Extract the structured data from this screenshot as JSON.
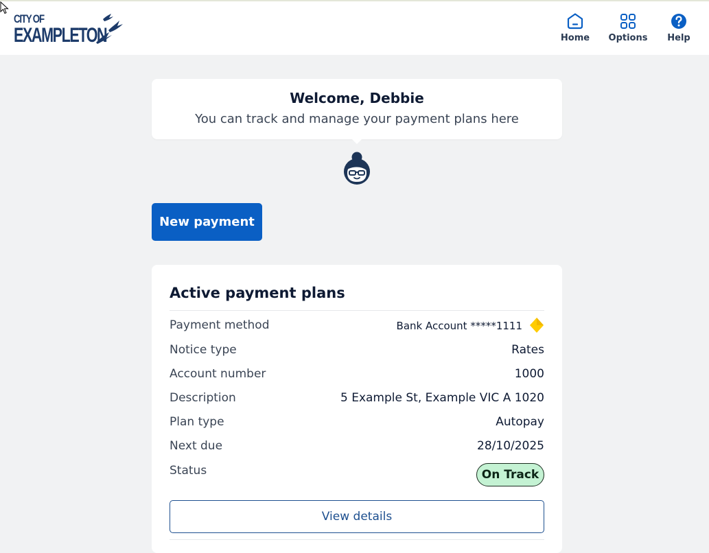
{
  "brand": {
    "logo_line1": "CITY OF",
    "logo_line2": "EXAMPLETON",
    "color": "#1d3b6a"
  },
  "nav": [
    {
      "label": "Home",
      "icon": "house-icon"
    },
    {
      "label": "Options",
      "icon": "grid-icon"
    },
    {
      "label": "Help",
      "icon": "help-icon"
    }
  ],
  "welcome": {
    "title": "Welcome, Debbie",
    "subtitle": "You can track and manage your payment plans here"
  },
  "actions": {
    "new_payment": "New payment"
  },
  "plans": {
    "title": "Active payment plans",
    "rows": [
      {
        "label": "Payment method",
        "value": "Bank Account *****1111"
      },
      {
        "label": "Notice type",
        "value": "Rates"
      },
      {
        "label": "Account number",
        "value": "1000"
      },
      {
        "label": "Description",
        "value": "5 Example St, Example VIC A 1020"
      },
      {
        "label": "Plan type",
        "value": "Autopay"
      },
      {
        "label": "Next due",
        "value": "28/10/2025"
      },
      {
        "label": "Status",
        "value": "On Track"
      }
    ],
    "view_details": "View details"
  },
  "colors": {
    "primary": "#0a5fc4",
    "status_bg": "#c4f2d3",
    "page_bg": "#f1f2f3"
  }
}
